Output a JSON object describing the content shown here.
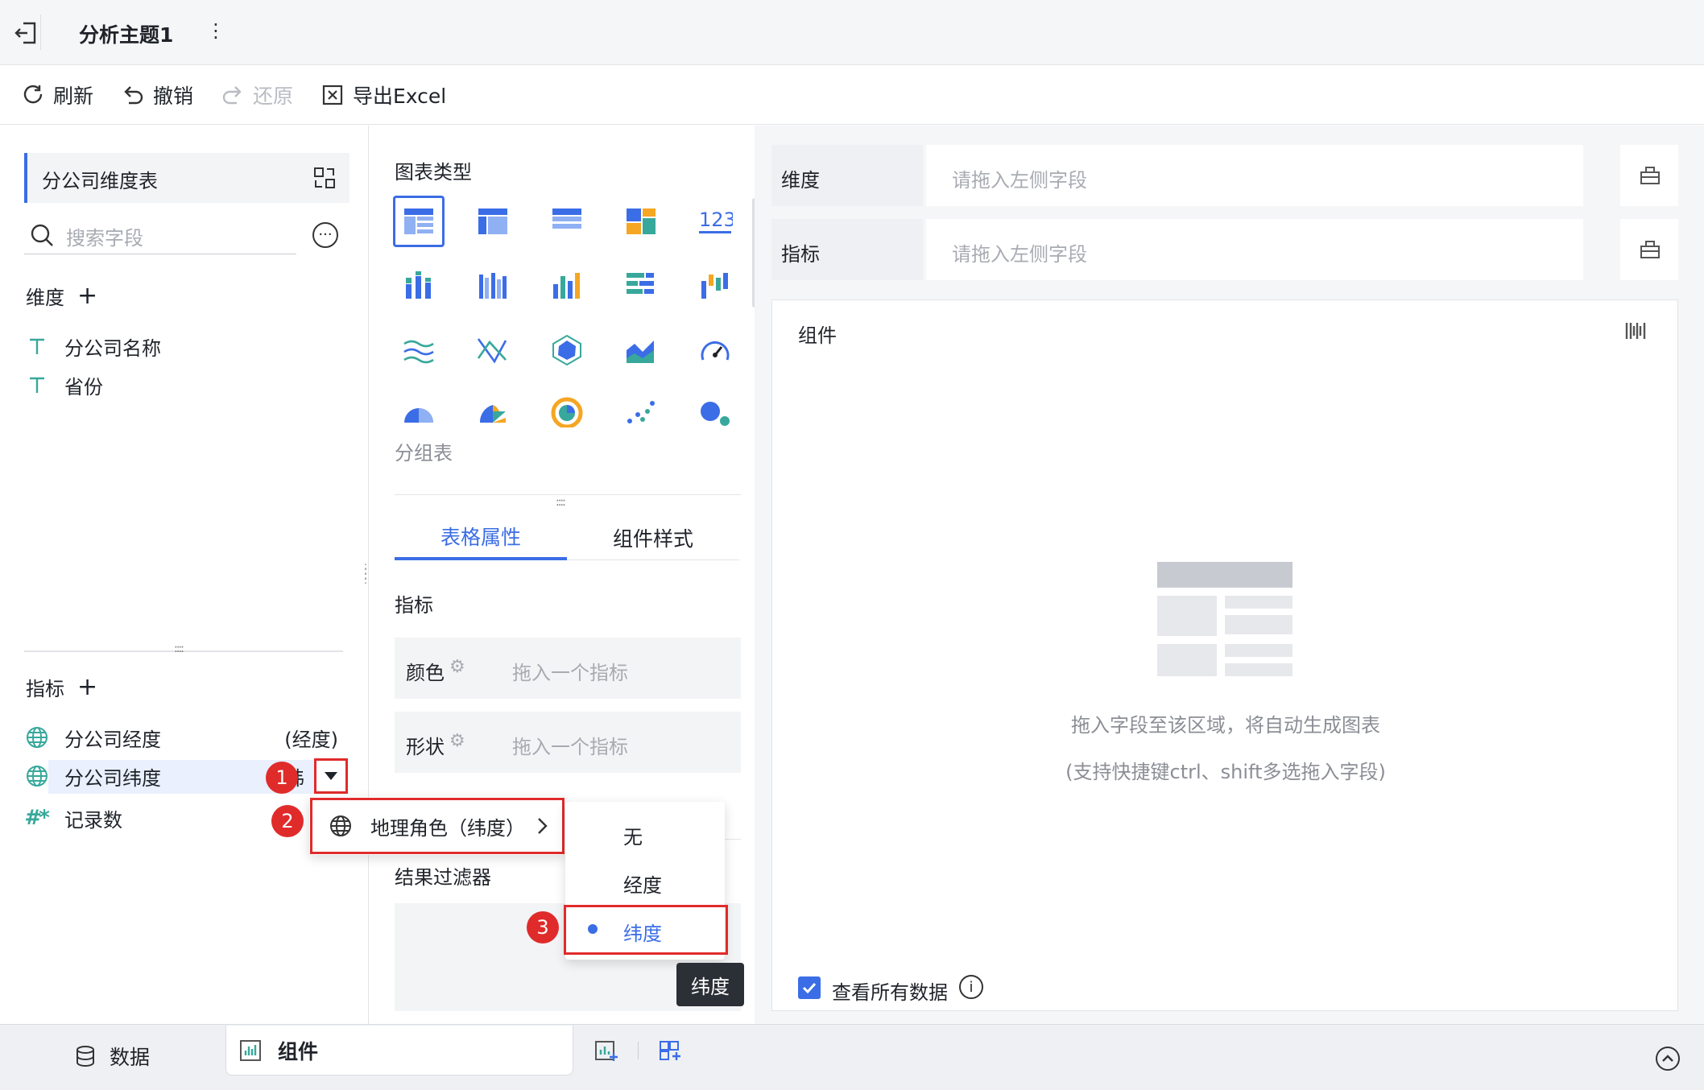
{
  "header": {
    "title": "分析主题1",
    "more": "⋮"
  },
  "toolbar": {
    "refresh": "刷新",
    "undo": "撤销",
    "redo": "还原",
    "export": "导出Excel"
  },
  "left": {
    "table_name": "分公司维度表",
    "search_placeholder": "搜索字段",
    "dimension_label": "维度",
    "dimensions": [
      "分公司名称",
      "省份"
    ],
    "measure_label": "指标",
    "measures": [
      {
        "name": "分公司经度",
        "role": "(经度)"
      },
      {
        "name": "分公司纬度",
        "role": "(纬"
      },
      {
        "name": "记录数",
        "role": ""
      }
    ]
  },
  "middle": {
    "chart_type_label": "图表类型",
    "selected_chart_name": "分组表",
    "tabs": [
      "表格属性",
      "组件样式"
    ],
    "measure_section": "指标",
    "color_label": "颜色",
    "shape_label": "形状",
    "drag_measure_placeholder": "拖入一个指标",
    "filter_label": "结果过滤器"
  },
  "right": {
    "dimension_label": "维度",
    "measure_label": "指标",
    "drop_placeholder": "请拖入左侧字段",
    "component_label": "组件",
    "empty_hint_1": "拖入字段至该区域，将自动生成图表",
    "empty_hint_2": "(支持快捷键ctrl、shift多选拖入字段)",
    "view_all_data": "查看所有数据"
  },
  "context_menu": {
    "geo_role": "地理角色（纬度）",
    "sub_options": [
      "无",
      "经度",
      "纬度"
    ],
    "selected": "纬度",
    "tooltip": "纬度"
  },
  "badges": [
    "1",
    "2",
    "3"
  ],
  "bottom": {
    "data_tab": "数据",
    "component_tab": "组件"
  },
  "colors": {
    "accent": "#3b6de6",
    "red": "#e02b2b",
    "teal": "#37a89b"
  }
}
